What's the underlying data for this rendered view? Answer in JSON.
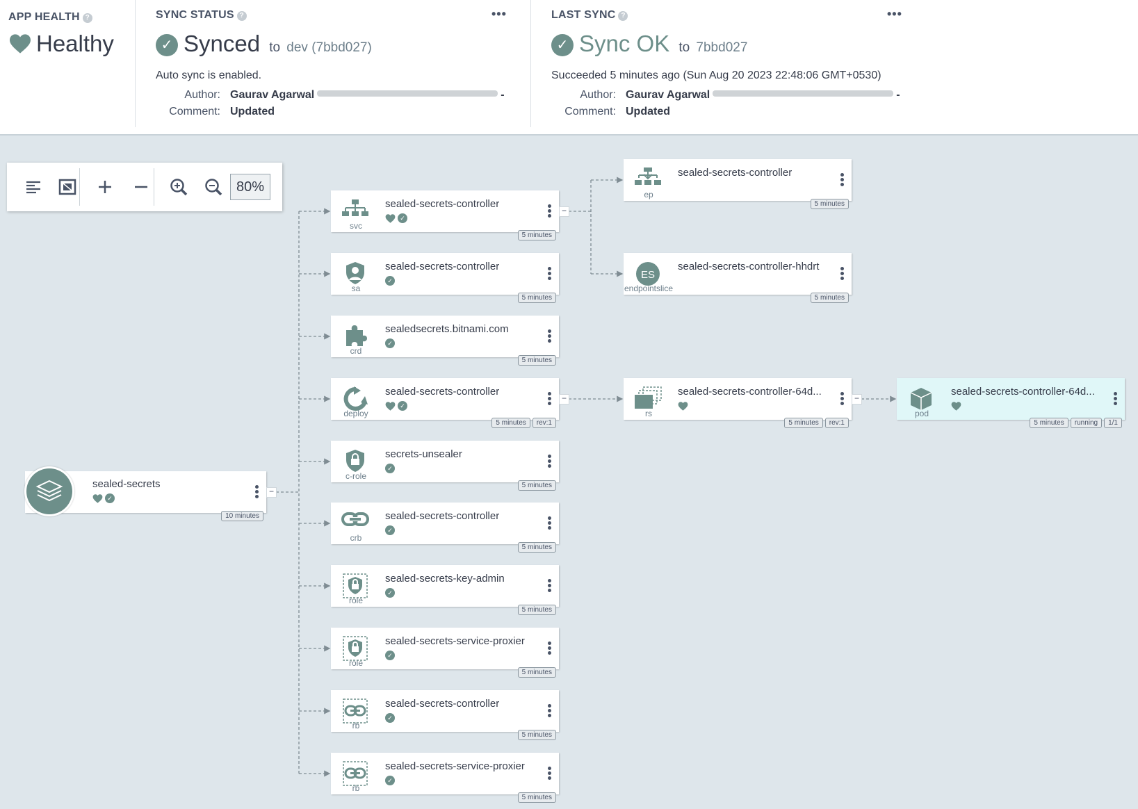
{
  "header": {
    "health": {
      "caption": "APP HEALTH",
      "help": "?",
      "status": "Healthy"
    },
    "sync_status": {
      "caption": "SYNC STATUS",
      "help": "?",
      "menu": "•••",
      "status": "Synced",
      "to": "to",
      "target": "dev (7bbd027)",
      "auto_sync": "Auto sync is enabled.",
      "author_label": "Author:",
      "author": "Gaurav Agarwal",
      "author_suffix": "-",
      "comment_label": "Comment:",
      "comment": "Updated"
    },
    "last_sync": {
      "caption": "LAST SYNC",
      "help": "?",
      "menu": "•••",
      "status": "Sync OK",
      "to": "to",
      "target": "7bbd027",
      "succeeded": "Succeeded 5 minutes ago (Sun Aug 20 2023 22:48:06 GMT+0530)",
      "author_label": "Author:",
      "author": "Gaurav Agarwal",
      "author_suffix": "-",
      "comment_label": "Comment:",
      "comment": "Updated"
    }
  },
  "toolbar": {
    "zoom": "80%"
  },
  "colors": {
    "icon": "#6d8f8a",
    "pod_bg": "#e0f7f8",
    "canvas": "#dee6eb",
    "edge": "#7f8c93"
  },
  "root": {
    "name": "sealed-secrets",
    "badges": [
      "10 minutes"
    ],
    "collapse": "−"
  },
  "children": [
    {
      "kind": "svc",
      "icon": "service-icon",
      "name": "sealed-secrets-controller",
      "health": true,
      "synced": true,
      "badges": [
        "5 minutes"
      ]
    },
    {
      "kind": "sa",
      "icon": "service-account-icon",
      "name": "sealed-secrets-controller",
      "health": false,
      "synced": true,
      "badges": [
        "5 minutes"
      ]
    },
    {
      "kind": "crd",
      "icon": "puzzle-icon",
      "name": "sealedsecrets.bitnami.com",
      "health": false,
      "synced": true,
      "badges": [
        "5 minutes"
      ]
    },
    {
      "kind": "deploy",
      "icon": "deploy-icon",
      "name": "sealed-secrets-controller",
      "health": true,
      "synced": true,
      "badges": [
        "5 minutes",
        "rev:1"
      ]
    },
    {
      "kind": "c-role",
      "icon": "cluster-role-icon",
      "name": "secrets-unsealer",
      "health": false,
      "synced": true,
      "badges": [
        "5 minutes"
      ]
    },
    {
      "kind": "crb",
      "icon": "link-icon",
      "name": "sealed-secrets-controller",
      "health": false,
      "synced": true,
      "badges": [
        "5 minutes"
      ]
    },
    {
      "kind": "role",
      "icon": "role-icon",
      "name": "sealed-secrets-key-admin",
      "health": false,
      "synced": true,
      "badges": [
        "5 minutes"
      ]
    },
    {
      "kind": "role",
      "icon": "role-icon",
      "name": "sealed-secrets-service-proxier",
      "health": false,
      "synced": true,
      "badges": [
        "5 minutes"
      ]
    },
    {
      "kind": "rb",
      "icon": "role-binding-icon",
      "name": "sealed-secrets-controller",
      "health": false,
      "synced": true,
      "badges": [
        "5 minutes"
      ]
    },
    {
      "kind": "rb",
      "icon": "role-binding-icon",
      "name": "sealed-secrets-service-proxier",
      "health": false,
      "synced": true,
      "badges": [
        "5 minutes"
      ]
    }
  ],
  "svc_children": [
    {
      "kind": "ep",
      "icon": "endpoints-icon",
      "name": "sealed-secrets-controller",
      "badges": [
        "5 minutes"
      ]
    },
    {
      "kind": "endpointslice",
      "icon": "endpointslice-icon",
      "icon_text": "ES",
      "name": "sealed-secrets-controller-hhdrt",
      "badges": [
        "5 minutes"
      ]
    }
  ],
  "replicaset": {
    "kind": "rs",
    "icon": "replicaset-icon",
    "name": "sealed-secrets-controller-64d...",
    "badges": [
      "5 minutes",
      "rev:1"
    ]
  },
  "pod": {
    "kind": "pod",
    "icon": "pod-icon",
    "name": "sealed-secrets-controller-64d...",
    "badges": [
      "5 minutes",
      "running",
      "1/1"
    ]
  }
}
